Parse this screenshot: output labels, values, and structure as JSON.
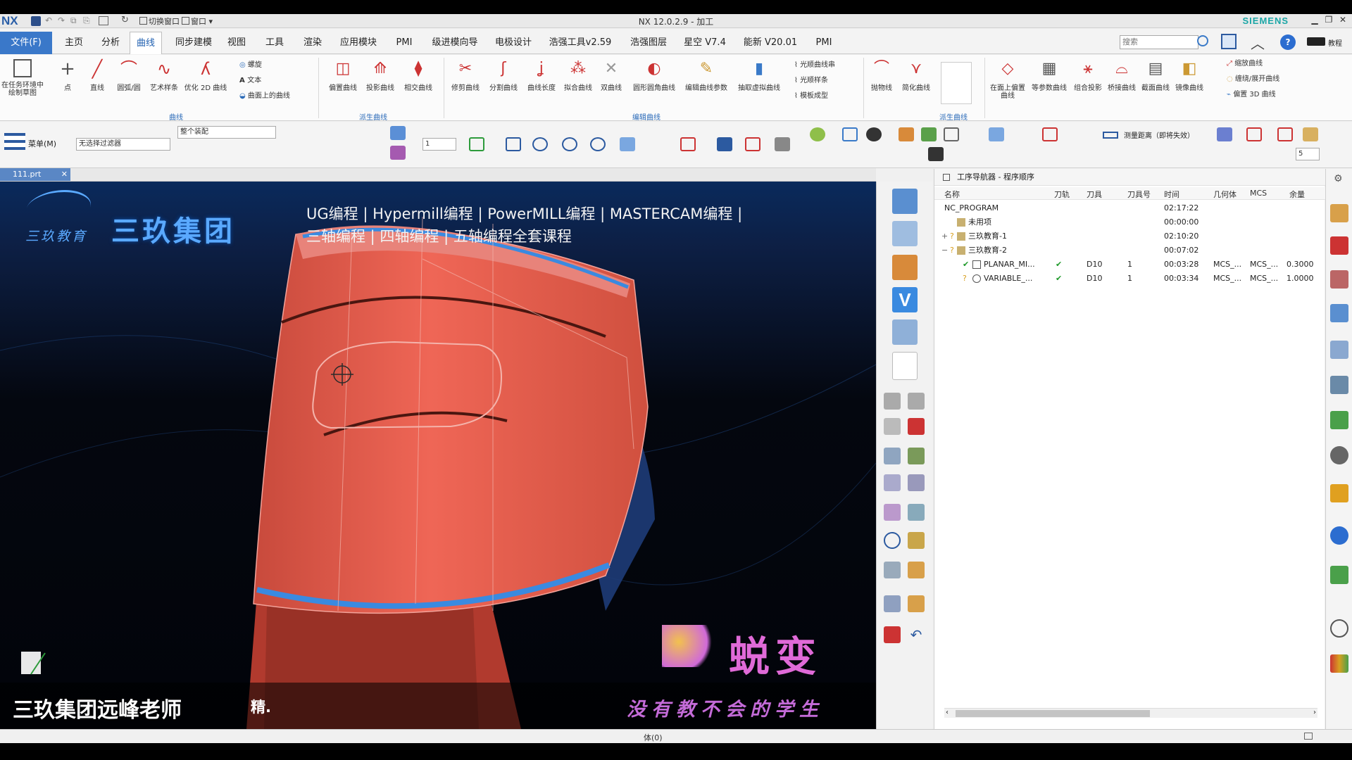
{
  "window": {
    "app_logo": "NX",
    "title": "NX 12.0.2.9 - 加工",
    "brand": "SIEMENS",
    "quick_access": [
      "切换窗口",
      "窗口"
    ]
  },
  "menu": {
    "file": "文件(F)",
    "tabs": [
      "主页",
      "分析",
      "曲线",
      "同步建模",
      "视图",
      "工具",
      "渲染",
      "应用模块",
      "PMI",
      "级进模向导",
      "电极设计",
      "浩强工具v2.59",
      "浩强图层",
      "星空 V7.4",
      "能新 V20.01",
      "PMI"
    ],
    "active_tab": "曲线",
    "search_placeholder": "搜索",
    "help_label": "教程"
  },
  "ribbon": {
    "curve_group": {
      "label": "曲线",
      "buttons": [
        "在任务环境中绘制草图",
        "点",
        "直线",
        "圆弧/圆",
        "艺术样条",
        "优化 2D 曲线"
      ],
      "small": [
        "螺旋",
        "文本",
        "曲面上的曲线"
      ]
    },
    "derived_group": {
      "label": "派生曲线",
      "buttons": [
        "偏置曲线",
        "投影曲线",
        "相交曲线"
      ]
    },
    "edit_group": {
      "label": "编辑曲线",
      "buttons": [
        "修剪曲线",
        "分割曲线",
        "曲线长度",
        "拟合曲线",
        "双曲线",
        "圆形圆角曲线",
        "编辑曲线参数",
        "抽取虚拟曲线"
      ],
      "small": [
        "光顺曲线串",
        "光顺样条",
        "模板成型"
      ]
    },
    "misc_buttons": [
      "抛物线",
      "简化曲线"
    ],
    "derived2_label": "派生曲线",
    "right_buttons": [
      "在面上偏置曲线",
      "等参数曲线",
      "组合投影",
      "桥接曲线",
      "截面曲线",
      "镜像曲线"
    ],
    "right_small": [
      "缩放曲线",
      "缠绕/展开曲线",
      "偏置 3D 曲线"
    ]
  },
  "toolbar2": {
    "menu_label": "菜单(M)",
    "filter": "无选择过滤器",
    "assembly": "整个装配",
    "layer": "1",
    "measure": "测量距离（即将失效）",
    "step": "5"
  },
  "document": {
    "tab": "111.prt"
  },
  "viewport": {
    "banner_title": "三玖集团",
    "logo_sub": "三玖教育",
    "banner_line1": "UG编程 | Hypermill编程 | PowerMILL编程 |  MASTERCAM编程 |",
    "banner_line2": "三轴编程 | 四轴编程 | 五轴编程全套课程",
    "teacher": "三玖集团远峰老师",
    "jing": "精.",
    "bianchang": "蜕变",
    "slogan": "没有教不会的学生",
    "colors": {
      "part": "#e05a4a",
      "banner_blue": "#5aa9ff",
      "slogan": "#c46bd8"
    }
  },
  "navigator": {
    "title": "工序导航器 - 程序顺序",
    "columns": [
      "名称",
      "刀轨",
      "刀具",
      "刀具号",
      "时间",
      "几何体",
      "MCS",
      "余量"
    ],
    "rows": [
      {
        "name": "NC_PROGRAM",
        "path": "",
        "tool": "",
        "tool_no": "",
        "time": "02:17:22",
        "geom": "",
        "mcs": "",
        "stock": ""
      },
      {
        "name": "未用项",
        "path": "",
        "tool": "",
        "tool_no": "",
        "time": "00:00:00",
        "geom": "",
        "mcs": "",
        "stock": ""
      },
      {
        "name": "三玖教育-1",
        "path": "",
        "tool": "",
        "tool_no": "",
        "time": "02:10:20",
        "geom": "",
        "mcs": "",
        "stock": ""
      },
      {
        "name": "三玖教育-2",
        "path": "",
        "tool": "",
        "tool_no": "",
        "time": "00:07:02",
        "geom": "",
        "mcs": "",
        "stock": ""
      },
      {
        "name": "PLANAR_MI...",
        "path": "✔",
        "tool": "D10",
        "tool_no": "1",
        "time": "00:03:28",
        "geom": "MCS_...",
        "mcs": "MCS_...",
        "stock": "0.3000"
      },
      {
        "name": "VARIABLE_...",
        "path": "✔",
        "tool": "D10",
        "tool_no": "1",
        "time": "00:03:34",
        "geom": "MCS_...",
        "mcs": "MCS_...",
        "stock": "1.0000"
      }
    ]
  },
  "status": {
    "text": "体(0)"
  }
}
